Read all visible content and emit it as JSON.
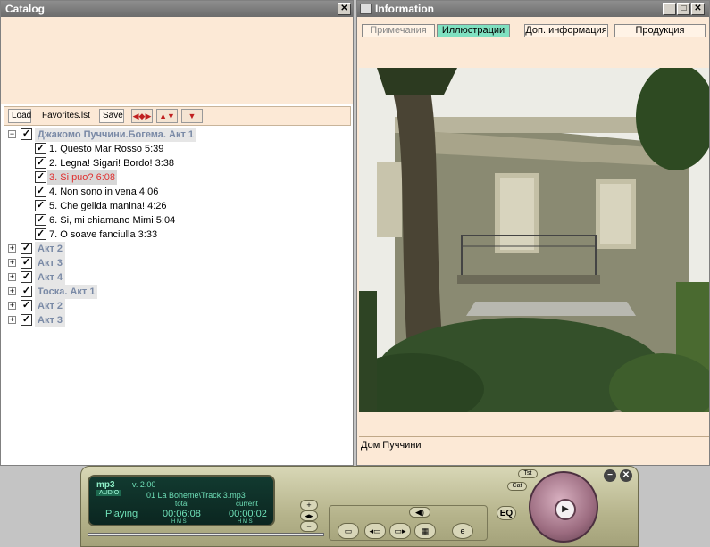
{
  "catalog": {
    "title": "Catalog",
    "close_icon": "close-icon",
    "toolbar": {
      "load_label": "Load",
      "playlist_name": "Favorites.lst",
      "save_label": "Save",
      "move_icons": [
        "move-all-icon",
        "move-up-down-icon",
        "move-down-icon"
      ]
    },
    "tree": {
      "root": {
        "label": "Джакомо Пуччини.Богема. Акт 1",
        "expanded": true,
        "tracks": [
          {
            "label": "1. Questo Mar Rosso 5:39"
          },
          {
            "label": "2. Legna! Sigari! Bordo! 3:38"
          },
          {
            "label": "3. Si puo? 6:08",
            "selected": true
          },
          {
            "label": "4. Non sono in vena 4:06"
          },
          {
            "label": "5. Che gelida manina! 4:26"
          },
          {
            "label": "6. Si, mi chiamano Mimi 5:04"
          },
          {
            "label": "7. O soave fanciulla 3:33"
          }
        ]
      },
      "nodes": [
        {
          "label": "Акт 2"
        },
        {
          "label": "Акт 3"
        },
        {
          "label": "Акт 4"
        },
        {
          "label": "Тоска. Акт 1"
        },
        {
          "label": "Акт 2"
        },
        {
          "label": "Акт 3"
        }
      ]
    }
  },
  "info": {
    "title": "Information",
    "tabs": [
      {
        "label": "Примечания",
        "state": "disabled"
      },
      {
        "label": "Иллюстрации",
        "state": "active"
      },
      {
        "label": "Доп. информация"
      },
      {
        "label": "Продукция"
      }
    ],
    "caption": "Дом Пуччини",
    "window_icons": [
      "minimize-icon",
      "maximize-icon",
      "close-icon"
    ]
  },
  "player": {
    "logo": "mp3",
    "logo_sub": "AUDIO",
    "version": "v. 2.00",
    "track": "01 La Boheme\\Track 3.mp3",
    "status": "Playing",
    "total_label": "total",
    "total_time": "00:06:08",
    "current_label": "current",
    "current_time": "00:00:02",
    "hms": "H M S",
    "eq_label": "EQ",
    "tst_label": "Tst",
    "cat_label": "Cat"
  },
  "colors": {
    "panel_bg": "#fce9d6",
    "active_tab": "#7fe0c0",
    "selected_track": "#e03030",
    "display_text": "#6fe0b8"
  }
}
